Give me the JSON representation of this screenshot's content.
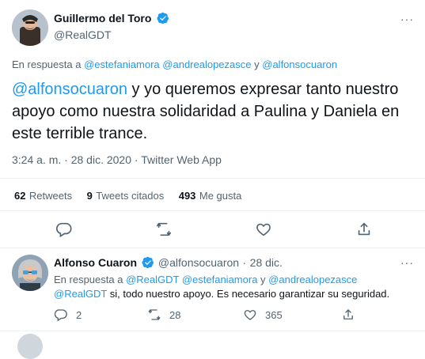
{
  "tweet": {
    "author_name": "Guillermo del Toro",
    "author_handle": "@RealGDT",
    "reply_prefix": "En respuesta a",
    "reply_users": [
      "@estefaniamora",
      "@andrealopezasce",
      "@alfonsocuaron"
    ],
    "reply_and": "y",
    "text_mention": "@alfonsocuaron",
    "text_body": "y yo queremos expresar tanto nuestro apoyo como nuestra solidaridad a Paulina y Daniela en este terrible trance.",
    "time": "3:24 a. m.",
    "date": "28 dic. 2020",
    "source": "Twitter Web App",
    "dot": "·",
    "stats": {
      "retweets_num": "62",
      "retweets_label": "Retweets",
      "quotes_num": "9",
      "quotes_label": "Tweets citados",
      "likes_num": "493",
      "likes_label": "Me gusta"
    },
    "more_icon": "···"
  },
  "reply": {
    "author_name": "Alfonso Cuaron",
    "author_handle": "@alfonsocuaron",
    "date": "28 dic.",
    "dot": "·",
    "reply_prefix": "En respuesta a",
    "reply_users": [
      "@RealGDT",
      "@estefaniamora",
      "@andrealopezasce"
    ],
    "reply_and": "y",
    "text_mention": "@RealGDT",
    "text_body": "si, todo nuestro apoyo. Es necesario garantizar su seguridad.",
    "counts": {
      "replies": "2",
      "retweets": "28",
      "likes": "365"
    },
    "more_icon": "···"
  },
  "colors": {
    "accent": "#1d9bf0",
    "text": "#0f1419",
    "muted": "#536471",
    "divider": "#eff3f4"
  }
}
